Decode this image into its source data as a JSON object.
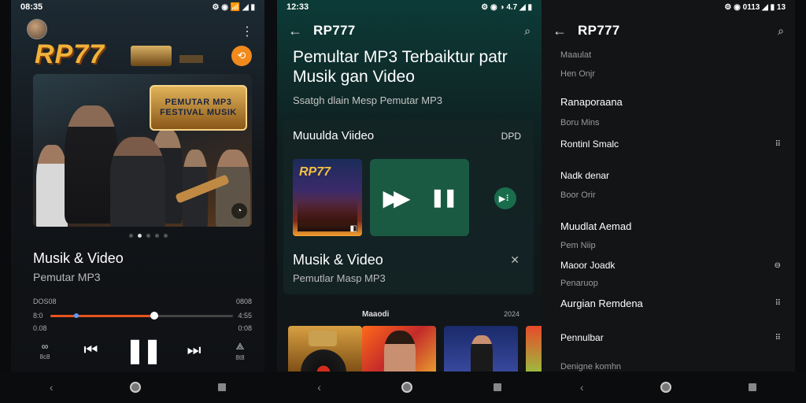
{
  "panel1": {
    "status": {
      "time": "08:35",
      "icons": "⚙ ◉ 📶 ◢ ▮"
    },
    "brand": "RP77",
    "hero_sign": [
      "PEMUTAR MP3",
      "FESTIVAL MUSIK"
    ],
    "carousel": {
      "count": 5,
      "active": 1
    },
    "title": "Musik & Video",
    "subtitle": "Pemutar MP3",
    "meta_left": "DOS08",
    "meta_right": "0808",
    "time_left_label": "8:0",
    "time_left": "0.08",
    "time_right": "4:55",
    "time_right2": "0:08",
    "progress": 0.57,
    "controls": {
      "left_label": "8c8",
      "right_label": "8t8"
    }
  },
  "panel2": {
    "status": {
      "time": "12:33",
      "icons": "⚙ ◉ ◑ 4.7 ◢ ▮"
    },
    "app_title": "RP777",
    "headline": "Pemultar MP3 Terbaiktur patr Musik gan Video",
    "description": "Ssatgh dlain Mesp Pemutar MP3",
    "video_card": {
      "heading": "Muuulda Viideo",
      "tag": "DPD",
      "thumb_brand": "RP77",
      "title": "Musik & Video",
      "subtitle": "Pemutlar Masp MP3"
    },
    "albums_label": "Maaodi",
    "albums_count": "2024"
  },
  "panel3": {
    "status": {
      "time": "",
      "icons": "⚙ ◉ 0113 ◢ ▮ 13"
    },
    "app_title": "RP777",
    "rows": [
      {
        "text": "Maaulat",
        "style": "dim",
        "action": ""
      },
      {
        "text": "Hen Onjr",
        "style": "dim",
        "action": ""
      },
      {
        "text": "Ranaporaana",
        "style": "big",
        "action": ""
      },
      {
        "text": "Boru Mins",
        "style": "dim",
        "action": ""
      },
      {
        "text": "Rontinl Smalc",
        "style": "norm",
        "action": "⠿"
      },
      {
        "text": "Nadk denar",
        "style": "norm",
        "action": ""
      },
      {
        "text": "Boor Orir",
        "style": "dim",
        "action": ""
      },
      {
        "text": "Muudlat Aemad",
        "style": "big",
        "action": ""
      },
      {
        "text": "Pem Niip",
        "style": "dim",
        "action": ""
      },
      {
        "text": "Maoor Joadk",
        "style": "norm",
        "action": "⊖"
      },
      {
        "text": "Penaruop",
        "style": "dim",
        "action": ""
      },
      {
        "text": "Aurgian Remdena",
        "style": "big",
        "action": "⠿"
      },
      {
        "text": "Pennulbar",
        "style": "norm",
        "action": "⠿"
      },
      {
        "text": "Denigne komhn",
        "style": "dim",
        "action": ""
      }
    ]
  },
  "colors": {
    "accent": "#e8541f",
    "fab": "#f08a1c",
    "green": "#1b5a42"
  }
}
